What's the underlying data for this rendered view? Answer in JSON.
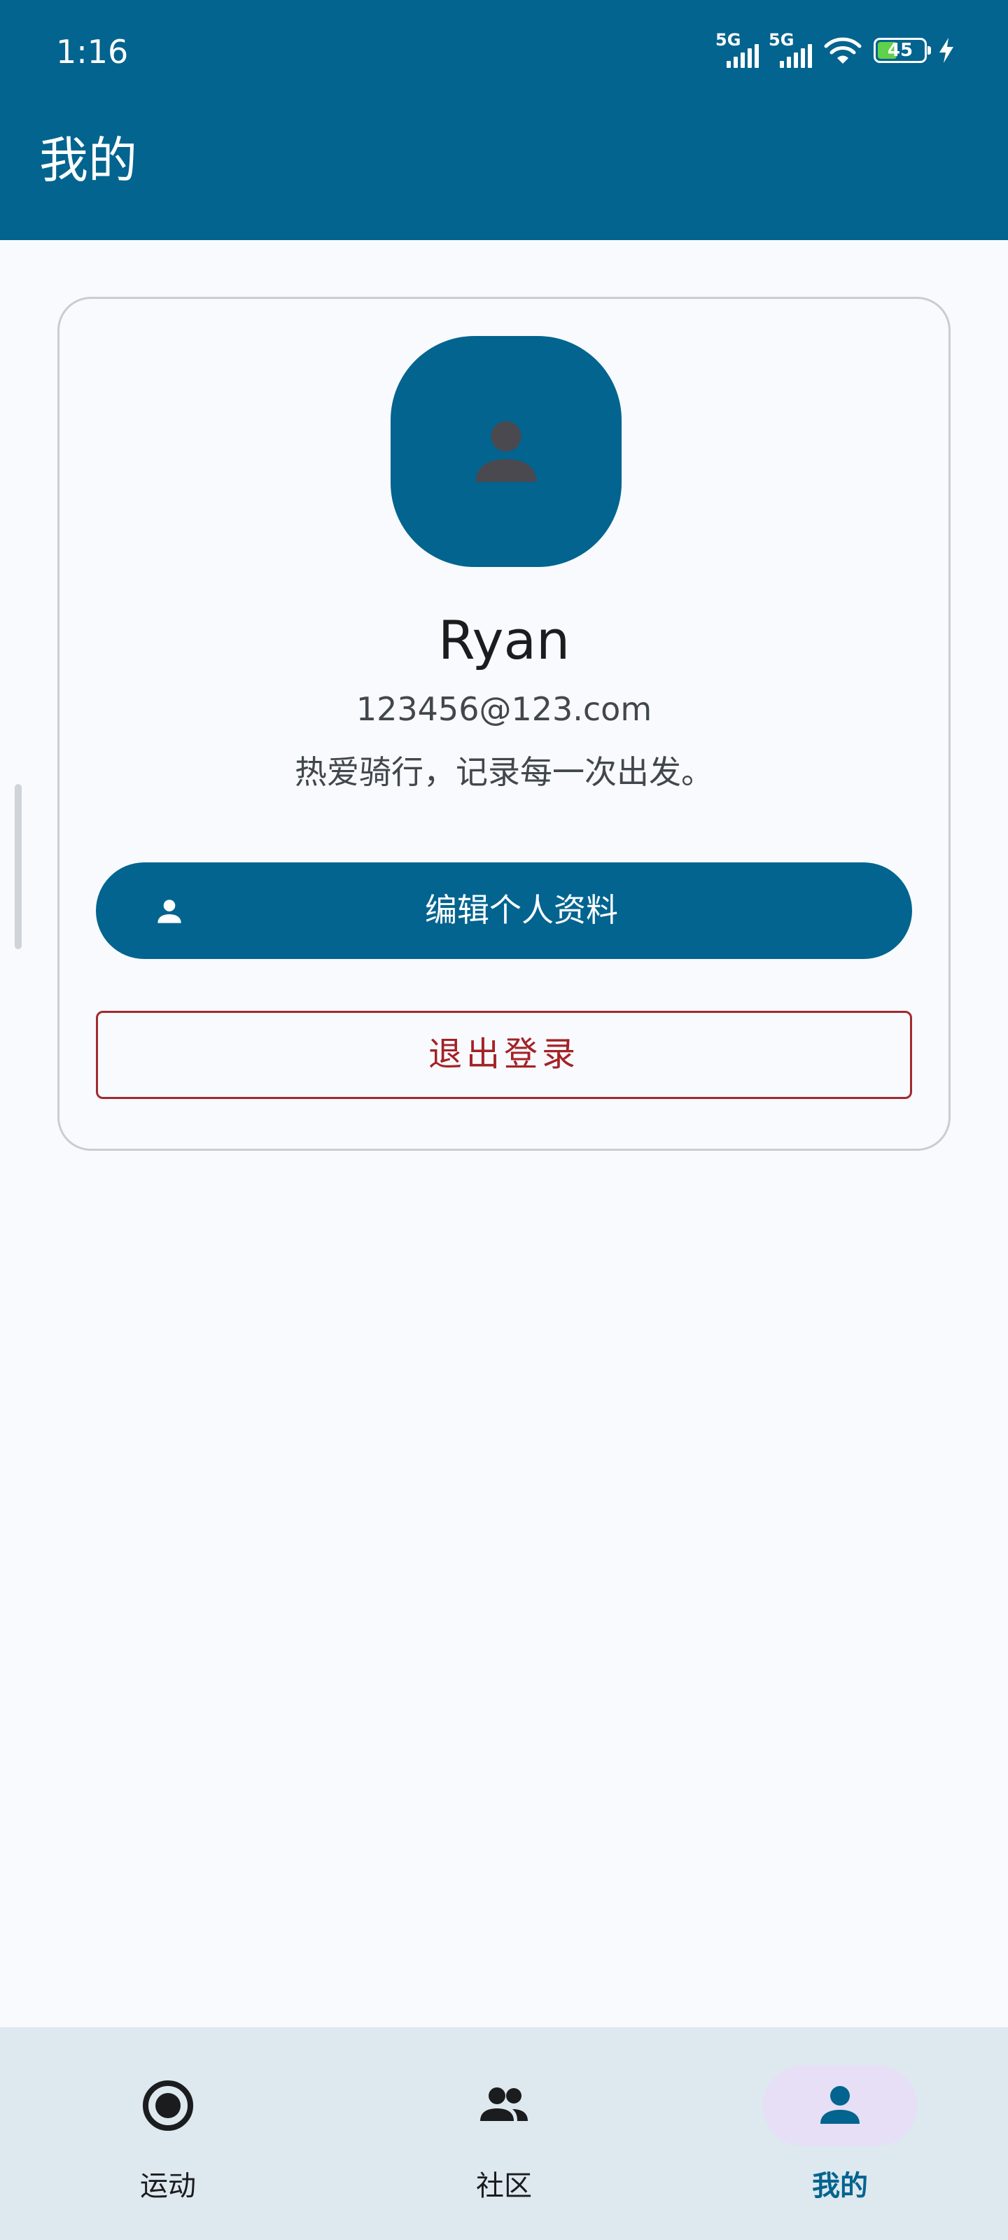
{
  "status_bar": {
    "time": "1:16",
    "signal_1_label": "5G",
    "signal_2_label": "5G",
    "battery_level": "45",
    "icons": [
      "signal-5g-icon",
      "signal-5g-icon",
      "wifi-icon",
      "battery-icon",
      "charging-icon"
    ]
  },
  "app_bar": {
    "title": "我的",
    "background_color": "#02648f"
  },
  "profile": {
    "avatar_icon": "person-icon",
    "name": "Ryan",
    "email": "123456@123.com",
    "bio": "热爱骑行，记录每一次出发。",
    "edit_button_label": "编辑个人资料",
    "edit_button_icon": "person-icon",
    "logout_button_label": "退出登录",
    "logout_color": "#a32226"
  },
  "bottom_nav": {
    "items": [
      {
        "label": "运动",
        "icon": "record-icon",
        "active": false
      },
      {
        "label": "社区",
        "icon": "group-icon",
        "active": false
      },
      {
        "label": "我的",
        "icon": "person-icon",
        "active": true
      }
    ],
    "active_color": "#02648f",
    "active_pill_color": "#e6dff5"
  }
}
